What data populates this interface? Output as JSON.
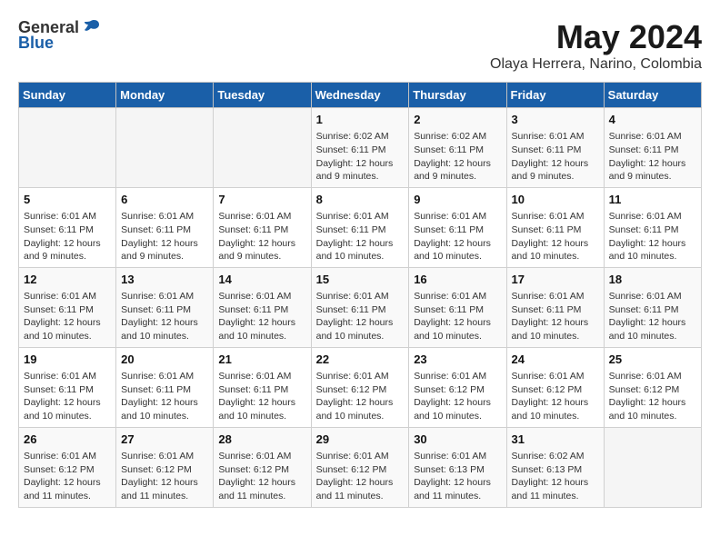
{
  "logo": {
    "general": "General",
    "blue": "Blue"
  },
  "title": {
    "month": "May 2024",
    "location": "Olaya Herrera, Narino, Colombia"
  },
  "weekdays": [
    "Sunday",
    "Monday",
    "Tuesday",
    "Wednesday",
    "Thursday",
    "Friday",
    "Saturday"
  ],
  "weeks": [
    [
      {
        "day": "",
        "info": ""
      },
      {
        "day": "",
        "info": ""
      },
      {
        "day": "",
        "info": ""
      },
      {
        "day": "1",
        "info": "Sunrise: 6:02 AM\nSunset: 6:11 PM\nDaylight: 12 hours\nand 9 minutes."
      },
      {
        "day": "2",
        "info": "Sunrise: 6:02 AM\nSunset: 6:11 PM\nDaylight: 12 hours\nand 9 minutes."
      },
      {
        "day": "3",
        "info": "Sunrise: 6:01 AM\nSunset: 6:11 PM\nDaylight: 12 hours\nand 9 minutes."
      },
      {
        "day": "4",
        "info": "Sunrise: 6:01 AM\nSunset: 6:11 PM\nDaylight: 12 hours\nand 9 minutes."
      }
    ],
    [
      {
        "day": "5",
        "info": "Sunrise: 6:01 AM\nSunset: 6:11 PM\nDaylight: 12 hours\nand 9 minutes."
      },
      {
        "day": "6",
        "info": "Sunrise: 6:01 AM\nSunset: 6:11 PM\nDaylight: 12 hours\nand 9 minutes."
      },
      {
        "day": "7",
        "info": "Sunrise: 6:01 AM\nSunset: 6:11 PM\nDaylight: 12 hours\nand 9 minutes."
      },
      {
        "day": "8",
        "info": "Sunrise: 6:01 AM\nSunset: 6:11 PM\nDaylight: 12 hours\nand 10 minutes."
      },
      {
        "day": "9",
        "info": "Sunrise: 6:01 AM\nSunset: 6:11 PM\nDaylight: 12 hours\nand 10 minutes."
      },
      {
        "day": "10",
        "info": "Sunrise: 6:01 AM\nSunset: 6:11 PM\nDaylight: 12 hours\nand 10 minutes."
      },
      {
        "day": "11",
        "info": "Sunrise: 6:01 AM\nSunset: 6:11 PM\nDaylight: 12 hours\nand 10 minutes."
      }
    ],
    [
      {
        "day": "12",
        "info": "Sunrise: 6:01 AM\nSunset: 6:11 PM\nDaylight: 12 hours\nand 10 minutes."
      },
      {
        "day": "13",
        "info": "Sunrise: 6:01 AM\nSunset: 6:11 PM\nDaylight: 12 hours\nand 10 minutes."
      },
      {
        "day": "14",
        "info": "Sunrise: 6:01 AM\nSunset: 6:11 PM\nDaylight: 12 hours\nand 10 minutes."
      },
      {
        "day": "15",
        "info": "Sunrise: 6:01 AM\nSunset: 6:11 PM\nDaylight: 12 hours\nand 10 minutes."
      },
      {
        "day": "16",
        "info": "Sunrise: 6:01 AM\nSunset: 6:11 PM\nDaylight: 12 hours\nand 10 minutes."
      },
      {
        "day": "17",
        "info": "Sunrise: 6:01 AM\nSunset: 6:11 PM\nDaylight: 12 hours\nand 10 minutes."
      },
      {
        "day": "18",
        "info": "Sunrise: 6:01 AM\nSunset: 6:11 PM\nDaylight: 12 hours\nand 10 minutes."
      }
    ],
    [
      {
        "day": "19",
        "info": "Sunrise: 6:01 AM\nSunset: 6:11 PM\nDaylight: 12 hours\nand 10 minutes."
      },
      {
        "day": "20",
        "info": "Sunrise: 6:01 AM\nSunset: 6:11 PM\nDaylight: 12 hours\nand 10 minutes."
      },
      {
        "day": "21",
        "info": "Sunrise: 6:01 AM\nSunset: 6:11 PM\nDaylight: 12 hours\nand 10 minutes."
      },
      {
        "day": "22",
        "info": "Sunrise: 6:01 AM\nSunset: 6:12 PM\nDaylight: 12 hours\nand 10 minutes."
      },
      {
        "day": "23",
        "info": "Sunrise: 6:01 AM\nSunset: 6:12 PM\nDaylight: 12 hours\nand 10 minutes."
      },
      {
        "day": "24",
        "info": "Sunrise: 6:01 AM\nSunset: 6:12 PM\nDaylight: 12 hours\nand 10 minutes."
      },
      {
        "day": "25",
        "info": "Sunrise: 6:01 AM\nSunset: 6:12 PM\nDaylight: 12 hours\nand 10 minutes."
      }
    ],
    [
      {
        "day": "26",
        "info": "Sunrise: 6:01 AM\nSunset: 6:12 PM\nDaylight: 12 hours\nand 11 minutes."
      },
      {
        "day": "27",
        "info": "Sunrise: 6:01 AM\nSunset: 6:12 PM\nDaylight: 12 hours\nand 11 minutes."
      },
      {
        "day": "28",
        "info": "Sunrise: 6:01 AM\nSunset: 6:12 PM\nDaylight: 12 hours\nand 11 minutes."
      },
      {
        "day": "29",
        "info": "Sunrise: 6:01 AM\nSunset: 6:12 PM\nDaylight: 12 hours\nand 11 minutes."
      },
      {
        "day": "30",
        "info": "Sunrise: 6:01 AM\nSunset: 6:13 PM\nDaylight: 12 hours\nand 11 minutes."
      },
      {
        "day": "31",
        "info": "Sunrise: 6:02 AM\nSunset: 6:13 PM\nDaylight: 12 hours\nand 11 minutes."
      },
      {
        "day": "",
        "info": ""
      }
    ]
  ]
}
